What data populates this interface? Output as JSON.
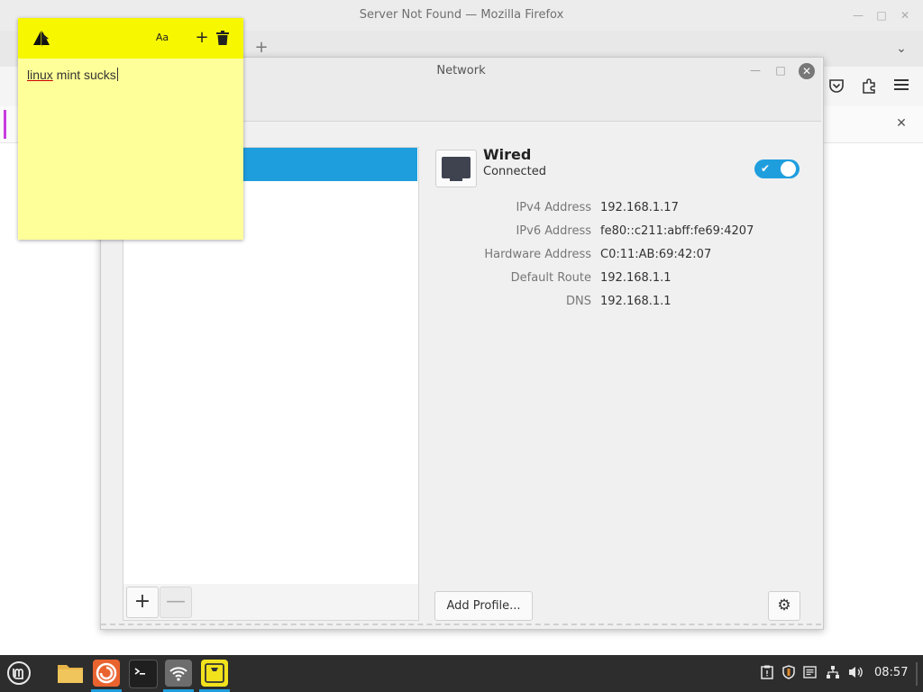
{
  "firefox": {
    "window_title": "Server Not Found — Mozilla Firefox",
    "new_tab_glyph": "+",
    "tab_list_glyph": "⌄",
    "notif_close_glyph": "✕"
  },
  "network": {
    "window_title": "Network",
    "wired": {
      "title": "Wired",
      "status": "Connected",
      "enabled": true
    },
    "properties": [
      {
        "label": "IPv4 Address",
        "value": "192.168.1.17"
      },
      {
        "label": "IPv6 Address",
        "value": "fe80::c211:abff:fe69:4207"
      },
      {
        "label": "Hardware Address",
        "value": "C0:11:AB:69:42:07"
      },
      {
        "label": "Default Route",
        "value": "192.168.1.1"
      },
      {
        "label": "DNS",
        "value": "192.168.1.1"
      }
    ],
    "add_profile_label": "Add Profile...",
    "add_device_glyph": "+",
    "remove_device_glyph": "—",
    "accent": "#1f9ede"
  },
  "sticky_note": {
    "text_underlined": "linux",
    "text_rest": " mint sucks",
    "font_button_glyph": "Aa",
    "add_button_glyph": "+",
    "background": "#ffff99",
    "header_color": "#f7f700"
  },
  "taskbar": {
    "clock": "08:57",
    "apps": [
      "files",
      "firefox",
      "terminal",
      "network-manager",
      "sticky-notes"
    ]
  }
}
